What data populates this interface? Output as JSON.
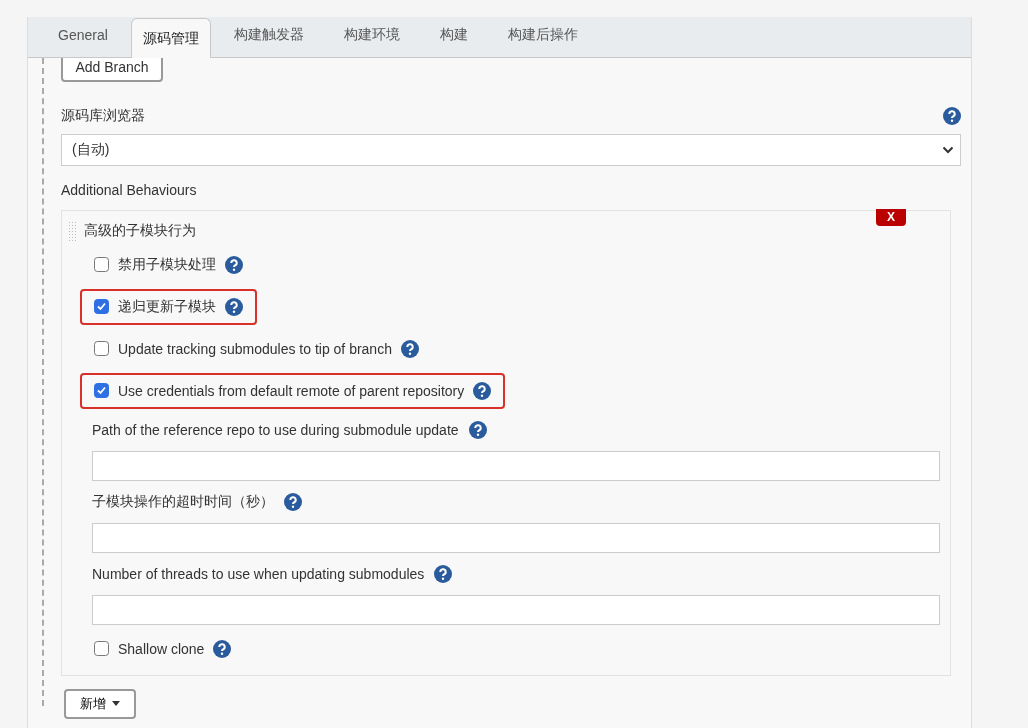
{
  "tabs": [
    {
      "label": "General",
      "selected": false
    },
    {
      "label": "源码管理",
      "selected": true
    },
    {
      "label": "构建触发器",
      "selected": false
    },
    {
      "label": "构建环境",
      "selected": false
    },
    {
      "label": "构建",
      "selected": false
    },
    {
      "label": "构建后操作",
      "selected": false
    }
  ],
  "add_branch_button": "Add Branch",
  "browser": {
    "label": "源码库浏览器",
    "value": "(自动)"
  },
  "behaviours_label": "Additional Behaviours",
  "behaviour": {
    "title": "高级的子模块行为",
    "delete": "X",
    "items": [
      {
        "kind": "checkbox",
        "label": "禁用子模块处理",
        "checked": false,
        "highlighted": false
      },
      {
        "kind": "checkbox",
        "label": "递归更新子模块",
        "checked": true,
        "highlighted": true
      },
      {
        "kind": "checkbox",
        "label": "Update tracking submodules to tip of branch",
        "checked": false,
        "highlighted": false
      },
      {
        "kind": "checkbox",
        "label": "Use credentials from default remote of parent repository",
        "checked": true,
        "highlighted": true
      },
      {
        "kind": "field",
        "label": "Path of the reference repo to use during submodule update"
      },
      {
        "kind": "field",
        "label": "子模块操作的超时时间（秒）"
      },
      {
        "kind": "field",
        "label": "Number of threads to use when updating submodules"
      },
      {
        "kind": "checkbox",
        "label": "Shallow clone",
        "checked": false,
        "highlighted": false
      }
    ]
  },
  "add_button": "新增"
}
